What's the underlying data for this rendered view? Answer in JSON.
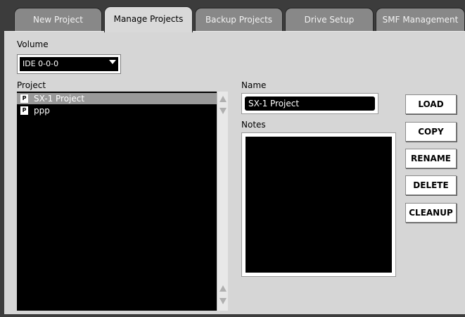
{
  "tabs": [
    {
      "label": "New Project",
      "active": false
    },
    {
      "label": "Manage Projects",
      "active": true
    },
    {
      "label": "Backup Projects",
      "active": false
    },
    {
      "label": "Drive Setup",
      "active": false
    },
    {
      "label": "SMF Management",
      "active": false
    }
  ],
  "volume": {
    "label": "Volume",
    "selected": "IDE 0-0-0"
  },
  "project_list": {
    "label": "Project",
    "items": [
      {
        "icon": "P",
        "name": "SX-1 Project",
        "selected": true
      },
      {
        "icon": "P",
        "name": "ppp",
        "selected": false
      }
    ]
  },
  "name": {
    "label": "Name",
    "value": "SX-1 Project"
  },
  "notes": {
    "label": "Notes",
    "value": ""
  },
  "actions": {
    "load": "LOAD",
    "copy": "COPY",
    "rename": "RENAME",
    "delete": "DELETE",
    "cleanup": "CLEANUP"
  },
  "colors": {
    "background": "#3c3c3c",
    "panel": "#d6d6d6",
    "tab_inactive": "#888888",
    "tab_active": "#d9d9d9",
    "list_bg": "#000000",
    "selection": "#9a9a9a"
  }
}
